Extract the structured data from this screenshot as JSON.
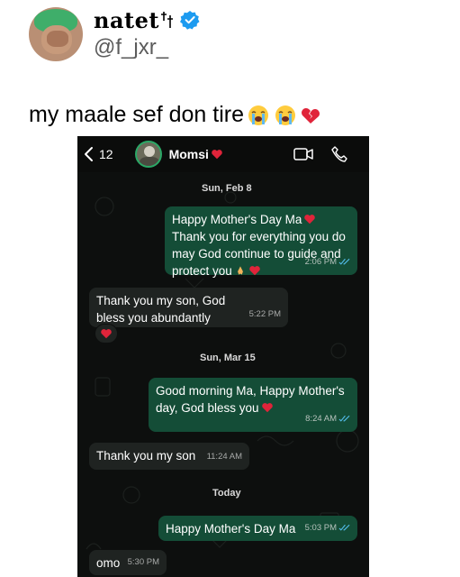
{
  "tweet": {
    "display_name": "natet",
    "handle": "@f_jxr_",
    "text": "my maale sef don tire",
    "emojis": [
      "loudly-crying-face",
      "loudly-crying-face",
      "broken-heart"
    ]
  },
  "chat": {
    "back_count": "12",
    "contact_name": "Momsi",
    "icons": [
      "chevron-left-icon",
      "video-call-icon",
      "phone-icon"
    ],
    "colors": {
      "outgoing": "#144d37",
      "incoming": "#1f2321",
      "background": "#0d0f0e",
      "read_tick": "#53bdeb"
    },
    "items": [
      {
        "type": "date",
        "text": "Sun, Feb 8"
      },
      {
        "type": "out",
        "text": "Happy Mother's Day Ma",
        "text2": "Thank you for everything you do may God continue to guide and protect you",
        "time": "2:06 PM"
      },
      {
        "type": "in",
        "text": "Thank you my son, God bless you abundantly",
        "time": "5:22 PM",
        "reaction": "red-heart"
      },
      {
        "type": "date",
        "text": "Sun, Mar 15"
      },
      {
        "type": "out",
        "text": "Good morning Ma, Happy Mother's day, God bless you",
        "time": "8:24 AM"
      },
      {
        "type": "in",
        "text": "Thank you my son",
        "time": "11:24 AM"
      },
      {
        "type": "date",
        "text": "Today"
      },
      {
        "type": "out",
        "text": "Happy Mother's Day Ma",
        "time": "5:03 PM"
      },
      {
        "type": "in",
        "text": "omo",
        "time": "5:30 PM"
      }
    ]
  }
}
